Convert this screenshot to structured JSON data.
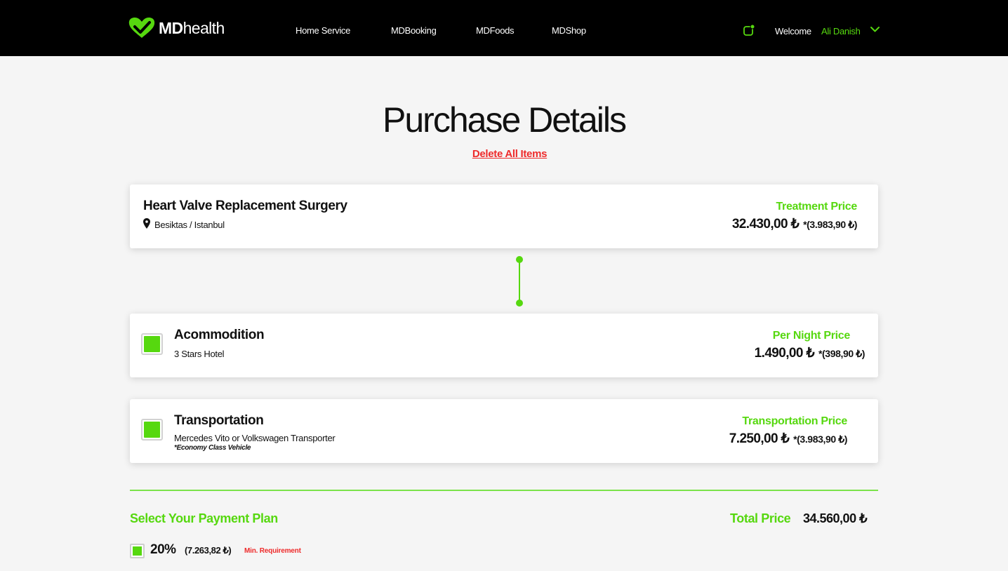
{
  "header": {
    "logo_bold": "MD",
    "logo_light": "health",
    "nav": [
      "Home Service",
      "MDBooking",
      "MDFoods",
      "MDShop"
    ],
    "welcome": "Welcome",
    "username": "Ali Danish",
    "accent": "#56d80f"
  },
  "page": {
    "title": "Purchase Details",
    "delete_all": "Delete All Items"
  },
  "treatment": {
    "title": "Heart Valve Replacement Surgery",
    "location": "Besiktas / Istanbul",
    "price_label": "Treatment Price",
    "price": "32.430,00 ₺",
    "price_alt": "*(3.983,90 ₺)"
  },
  "accommodation": {
    "title": "Acommodition",
    "subtitle": "3 Stars Hotel",
    "price_label": "Per Night Price",
    "price": "1.490,00 ₺",
    "price_alt": "*(398,90 ₺)",
    "checked": true
  },
  "transportation": {
    "title": "Transportation",
    "subtitle": "Mercedes Vito or Volkswagen Transporter",
    "note": "*Economy Class Vehicle",
    "price_label": "Transportation Price",
    "price": "7.250,00 ₺",
    "price_alt": "*(3.983,90 ₺)",
    "checked": true
  },
  "payment": {
    "heading": "Select Your Payment Plan",
    "total_label": "Total Price",
    "total_value": "34.560,00 ₺",
    "plans": [
      {
        "percent": "20%",
        "amount": "(7.263,82 ₺)",
        "note": "Min. Requirement",
        "checked": true
      }
    ]
  }
}
